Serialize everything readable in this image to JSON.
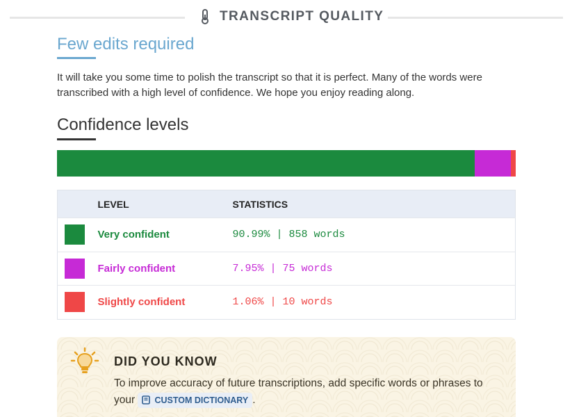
{
  "header": {
    "title": "TRANSCRIPT QUALITY",
    "icon": "thermometer-icon"
  },
  "summary": {
    "title": "Few edits required",
    "description": "It will take you some time to polish the transcript so that it is perfect. Many of the words were transcribed with a high level of confidence. We hope you enjoy reading along."
  },
  "confidence": {
    "title": "Confidence levels",
    "table_headers": {
      "level": "LEVEL",
      "statistics": "STATISTICS"
    },
    "levels": [
      {
        "label": "Very confident",
        "stat": "90.99% | 858 words",
        "percent": 90.99,
        "color": "#1b8a3e"
      },
      {
        "label": "Fairly confident",
        "stat": "7.95% | 75 words",
        "percent": 7.95,
        "color": "#c62ad6"
      },
      {
        "label": "Slightly confident",
        "stat": "1.06% | 10 words",
        "percent": 1.06,
        "color": "#ef4747"
      }
    ]
  },
  "tip": {
    "icon": "lightbulb-icon",
    "title": "DID YOU KNOW",
    "text_before": "To improve accuracy of future transcriptions, add specific words or phrases to your",
    "link_label": "CUSTOM DICTIONARY",
    "link_icon": "book-icon",
    "text_after": "."
  },
  "colors": {
    "accent_blue": "#6aa7cf",
    "table_header_bg": "#e8edf6",
    "tip_bg": "#faf4e4",
    "link_color": "#2f5d8f"
  }
}
